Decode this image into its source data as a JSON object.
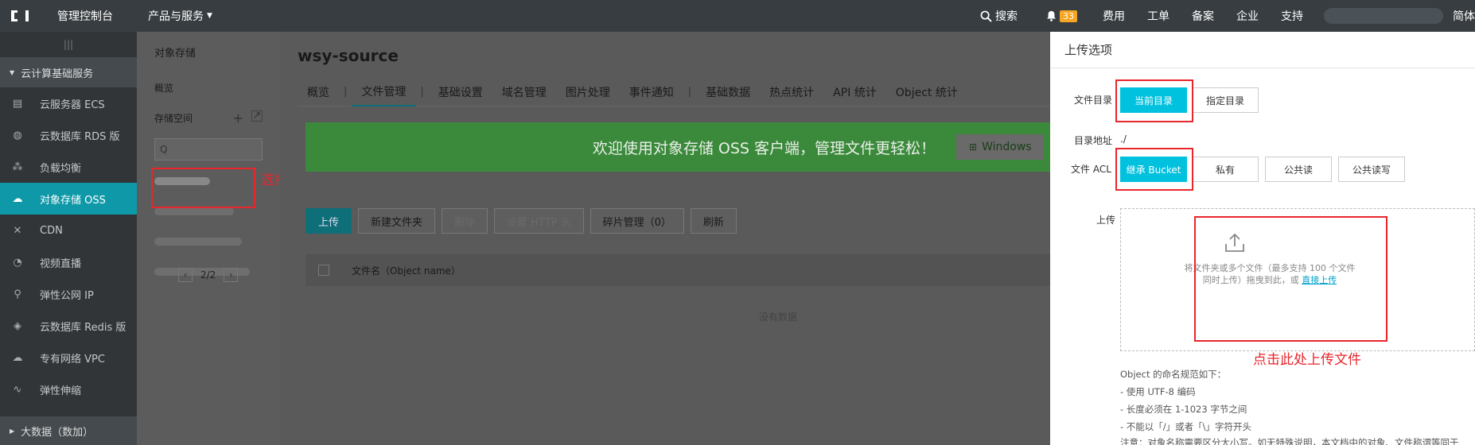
{
  "topbar": {
    "console": "管理控制台",
    "products": "产品与服务",
    "search": "搜索",
    "notif_count": "33",
    "links": [
      "费用",
      "工单",
      "备案",
      "企业",
      "支持"
    ],
    "lang": "简体"
  },
  "sidebar": {
    "group": "云计算基础服务",
    "items": [
      {
        "label": "云服务器 ECS",
        "icon": "server-icon",
        "glyph": "▤"
      },
      {
        "label": "云数据库 RDS 版",
        "icon": "database-icon",
        "glyph": "◍"
      },
      {
        "label": "负载均衡",
        "icon": "balance-icon",
        "glyph": "⁂"
      },
      {
        "label": "对象存储 OSS",
        "icon": "cloud-icon",
        "glyph": "☁"
      },
      {
        "label": "CDN",
        "icon": "cdn-icon",
        "glyph": "✕"
      },
      {
        "label": "视频直播",
        "icon": "live-icon",
        "glyph": "◔"
      },
      {
        "label": "弹性公网 IP",
        "icon": "ip-icon",
        "glyph": "⚲"
      },
      {
        "label": "云数据库 Redis 版",
        "icon": "redis-icon",
        "glyph": "◈"
      },
      {
        "label": "专有网络 VPC",
        "icon": "vpc-icon",
        "glyph": "☁"
      },
      {
        "label": "弹性伸缩",
        "icon": "scaling-icon",
        "glyph": "∿"
      }
    ],
    "bottom_group": "大数据（数加）"
  },
  "subnav": {
    "title": "对象存储",
    "overview": "概览",
    "storage_space": "存储空间",
    "search_glyph": "Q",
    "pager": "2/2",
    "annotation": "选择Bucket"
  },
  "main": {
    "bucket_name": "wsy-source",
    "tabs": [
      "概览",
      "文件管理",
      "基础设置",
      "域名管理",
      "图片处理",
      "事件通知",
      "基础数据",
      "热点统计",
      "API 统计",
      "Object 统计"
    ],
    "banner_text": "欢迎使用对象存储 OSS 客户端，管理文件更轻松！",
    "windows_btn": "Windows",
    "toolbar": [
      "上传",
      "新建文件夹",
      "删除",
      "设置 HTTP 头",
      "碎片管理（0）",
      "刷新"
    ],
    "column": "文件名（Object name）",
    "empty": "没有数据"
  },
  "panel": {
    "title": "上传选项",
    "dir_label": "文件目录",
    "dir_current": "当前目录",
    "dir_specify": "指定目录",
    "addr_label": "目录地址",
    "addr_value": "./",
    "acl_label": "文件 ACL",
    "acl_options": [
      "继承 Bucket",
      "私有",
      "公共读",
      "公共读写"
    ],
    "upload_label": "上传",
    "drop_line1": "将文件夹或多个文件（最多支持 100 个文件",
    "drop_line2": "同时上传）拖曳到此，或",
    "drop_link": "直接上传",
    "annotation": "点击此处上传文件",
    "rules_title": "Object 的命名规范如下：",
    "rules": [
      "- 使用 UTF-8 编码",
      "- 长度必须在 1-1023 字节之间",
      "- 不能以「/」或者「\\」字符开头"
    ],
    "note": "注意：对象名称需要区分大小写。如无特殊说明，本文档中的对象、文件称谓等同于 Object"
  },
  "colors": {
    "accent": "#00c1de",
    "annotation": "#e8262c",
    "topbar": "#373d41"
  }
}
